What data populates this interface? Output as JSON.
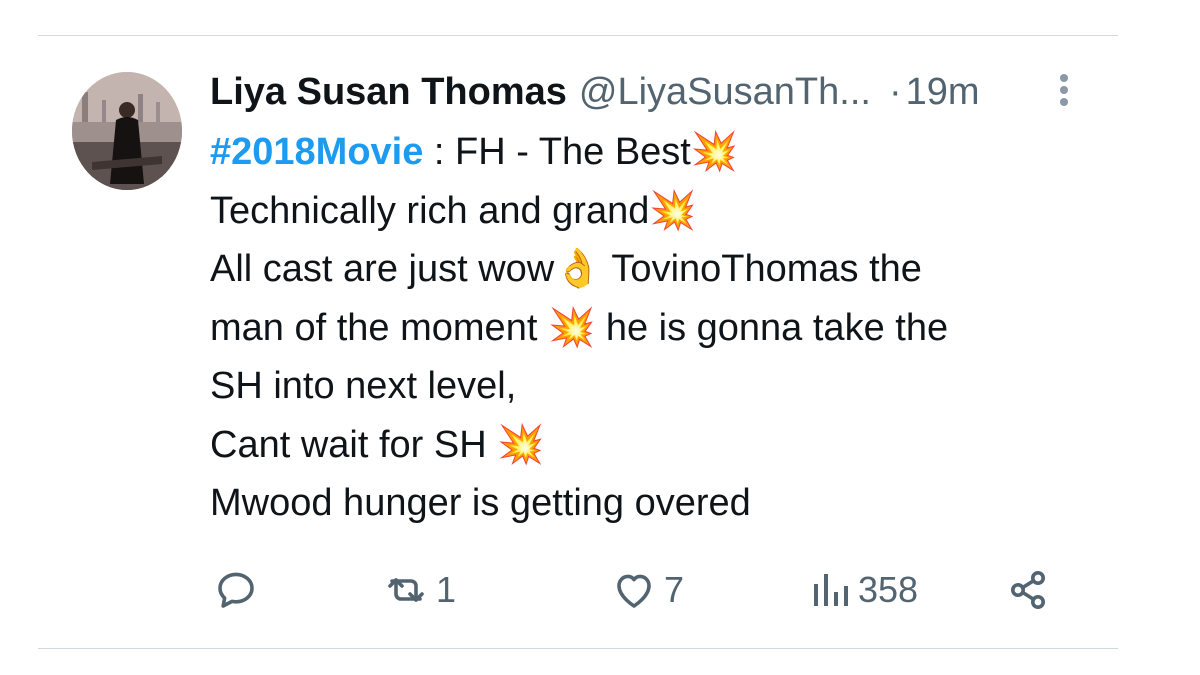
{
  "tweet": {
    "author_name": "Liya Susan Thomas",
    "author_handle": "@LiyaSusanTh...",
    "separator": "·",
    "timestamp": "19m",
    "lines": [
      {
        "hashtag": "#2018Movie",
        "text": " : FH - The Best",
        "emoji": "💥"
      },
      {
        "text": "Technically rich and grand",
        "emoji": "💥"
      },
      {
        "text": "All cast are just wow",
        "emoji": "👌",
        "text_after": " TovinoThomas the"
      },
      {
        "text": "man of the moment ",
        "emoji": "💥",
        "text_after": " he is gonna  take the"
      },
      {
        "text": "SH into next level,"
      },
      {
        "text": "Cant wait for SH ",
        "emoji": "💥"
      },
      {
        "text": "Mwood hunger is getting overed"
      }
    ]
  },
  "actions": {
    "reply_icon": "reply-bubble-icon",
    "retweet_icon": "retweet-arrows-icon",
    "retweet_count": "1",
    "like_icon": "heart-outline-icon",
    "like_count": "7",
    "views_icon": "bar-chart-icon",
    "views_count": "358",
    "share_icon": "share-nodes-icon"
  },
  "colors": {
    "text": "#0f1419",
    "secondary": "#536471",
    "hashtag": "#1d9bf0",
    "divider": "#cfd9de"
  }
}
